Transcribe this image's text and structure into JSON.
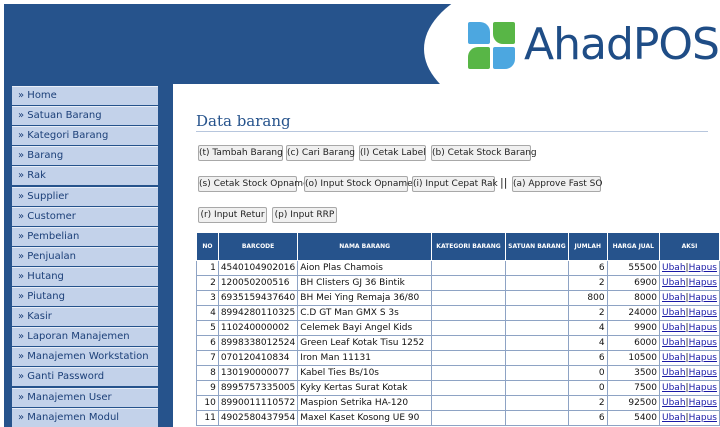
{
  "logo": {
    "text": "AhadPOS"
  },
  "sidebar": {
    "items": [
      "» Home",
      "» Satuan Barang",
      "» Kategori Barang",
      "» Barang",
      "» Rak",
      "» Supplier",
      "» Customer",
      "» Pembelian",
      "» Penjualan",
      "» Hutang",
      "» Piutang",
      "» Kasir",
      "» Laporan Manajemen",
      "» Manajemen Workstation",
      "» Ganti Password",
      "» Manajemen User",
      "» Manajemen Modul"
    ]
  },
  "page": {
    "title": "Data barang"
  },
  "buttons": {
    "tambah": "(t) Tambah Barang",
    "cari": "(c) Cari Barang",
    "cetak_label": "(l) Cetak Label",
    "cetak_stock": "(b) Cetak Stock Barang",
    "cetak_opname": "(s) Cetak Stock Opname",
    "input_opname": "(o) Input Stock Opname",
    "input_cepat": "(i) Input Cepat Rak",
    "separator": "||",
    "approve": "(a) Approve Fast SO",
    "input_retur": "(r) Input Retur",
    "input_rrp": "(p) Input RRP"
  },
  "table": {
    "headers": [
      "NO",
      "BARCODE",
      "NAMA BARANG",
      "KATEGORI BARANG",
      "SATUAN BARANG",
      "JUMLAH",
      "HARGA JUAL",
      "AKSI"
    ],
    "action_edit": "Ubah",
    "action_sep": "|",
    "action_delete": "Hapus",
    "rows": [
      [
        "1",
        "4540104902016",
        "Aion Plas Chamois",
        "",
        "",
        "6",
        "55500"
      ],
      [
        "2",
        "120050200516",
        "BH Clisters GJ 36 Bintik",
        "",
        "",
        "2",
        "6900"
      ],
      [
        "3",
        "6935159437640",
        "BH Mei Ying Remaja 36/80",
        "",
        "",
        "800",
        "8000"
      ],
      [
        "4",
        "8994280110325",
        "C.D GT Man GMX S 3s",
        "",
        "",
        "2",
        "24000"
      ],
      [
        "5",
        "110240000002",
        "Celemek Bayi Angel Kids",
        "",
        "",
        "4",
        "9900"
      ],
      [
        "6",
        "8998338012524",
        "Green Leaf Kotak Tisu 1252",
        "",
        "",
        "4",
        "6000"
      ],
      [
        "7",
        "070120410834",
        "Iron Man 11131",
        "",
        "",
        "6",
        "10500"
      ],
      [
        "8",
        "130190000077",
        "Kabel Ties Bs/10s",
        "",
        "",
        "0",
        "3500"
      ],
      [
        "9",
        "8995757335005",
        "Kyky Kertas Surat Kotak",
        "",
        "",
        "0",
        "7500"
      ],
      [
        "10",
        "8990011110572",
        "Maspion Setrika HA-120",
        "",
        "",
        "2",
        "92500"
      ],
      [
        "11",
        "4902580437954",
        "Maxel Kaset Kosong UE 90",
        "",
        "",
        "6",
        "5400"
      ]
    ]
  },
  "colors": {
    "header_bg": "#26538c",
    "menu_item_bg": "#c3d2ea",
    "logo_blue": "#4ca7e0",
    "logo_green": "#58b646"
  }
}
